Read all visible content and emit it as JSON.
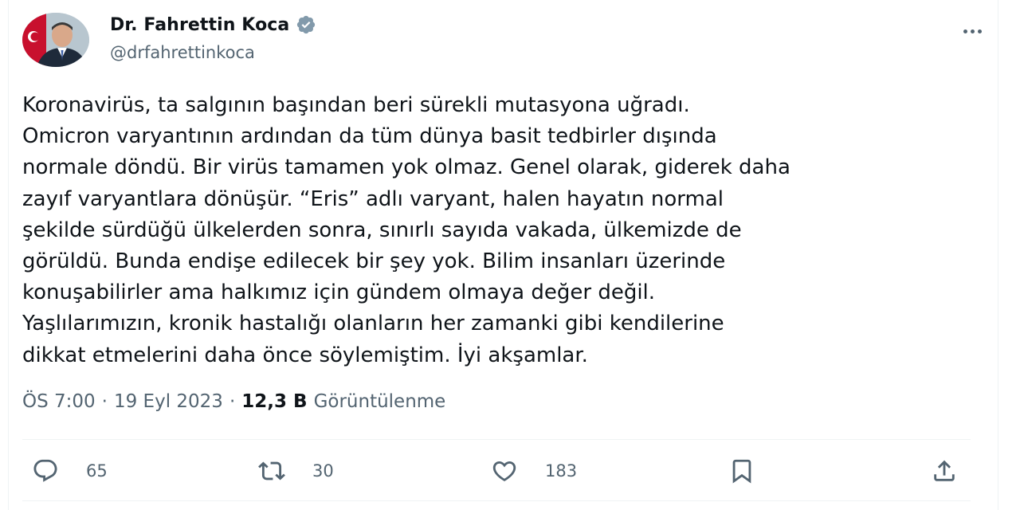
{
  "author": {
    "name": "Dr. Fahrettin Koca",
    "handle": "@drfahrettinkoca"
  },
  "tweet": {
    "lines": [
      "Koronavirüs, ta salgının başından beri sürekli mutasyona uğradı.",
      "Omicron varyantının ardından da tüm dünya basit tedbirler dışında",
      "normale döndü. Bir virüs tamamen yok olmaz. Genel olarak, giderek daha",
      "zayıf varyantlara dönüşür. “Eris” adlı varyant, halen hayatın normal",
      "şekilde sürdüğü ülkelerden sonra, sınırlı sayıda vakada, ülkemizde de",
      "görüldü. Bunda endişe edilecek bir şey yok. Bilim insanları üzerinde",
      "konuşabilirler ama halkımız için gündem olmaya değer değil.",
      "Yaşlılarımızın, kronik hastalığı olanların her zamanki gibi kendilerine",
      "dikkat etmelerini daha önce söylemiştim. İyi akşamlar."
    ]
  },
  "meta": {
    "time": "ÖS 7:00",
    "separator": "·",
    "date": "19 Eyl 2023",
    "views_count": "12,3 B",
    "views_label": "Görüntülenme"
  },
  "actions": {
    "replies": "65",
    "retweets": "30",
    "likes": "183"
  },
  "icons": {
    "verified": "verified-badge-icon",
    "more": "more-icon",
    "reply": "reply-icon",
    "retweet": "retweet-icon",
    "like": "heart-icon",
    "bookmark": "bookmark-icon",
    "share": "share-icon"
  },
  "colors": {
    "text": "#0f1419",
    "secondary": "#536471",
    "divider": "#eff3f4",
    "verified_badge": "#829aab"
  }
}
